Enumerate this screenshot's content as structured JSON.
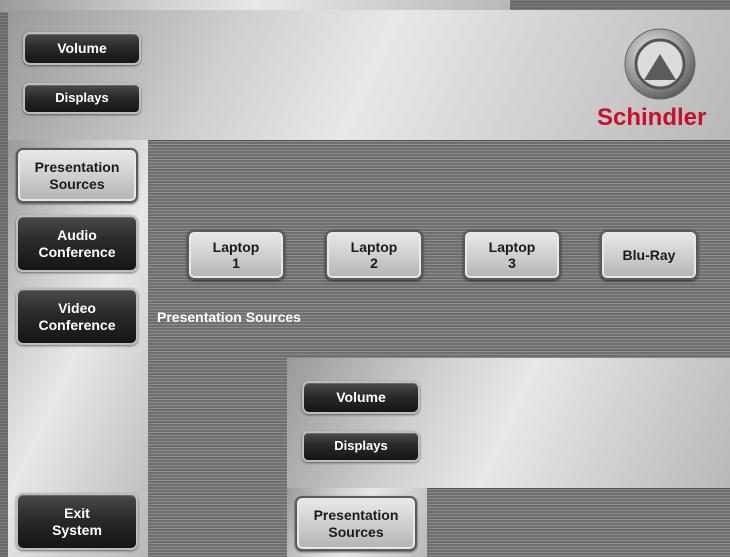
{
  "main": {
    "buttons": {
      "volume": "Volume",
      "displays": "Displays"
    },
    "sidebar": {
      "presentation_line1": "Presentation",
      "presentation_line2": "Sources",
      "audio_line1": "Audio",
      "audio_line2": "Conference",
      "video_line1": "Video",
      "video_line2": "Conference",
      "exit_line1": "Exit",
      "exit_line2": "System"
    },
    "logo": {
      "brand_name": "Schindler"
    },
    "sources": [
      {
        "line1": "Laptop",
        "line2": "1"
      },
      {
        "line1": "Laptop",
        "line2": "2"
      },
      {
        "line1": "Laptop",
        "line2": "3"
      },
      {
        "line1": "Blu-Ray",
        "line2": ""
      }
    ],
    "section_label": "Presentation Sources"
  },
  "nested": {
    "buttons": {
      "volume": "Volume",
      "displays": "Displays"
    },
    "sidebar": {
      "presentation_line1": "Presentation",
      "presentation_line2": "Sources"
    }
  },
  "colors": {
    "brand_red": "#c8102e",
    "button_dark": "#1f1f1f",
    "button_selected": "#cfcfcf"
  }
}
